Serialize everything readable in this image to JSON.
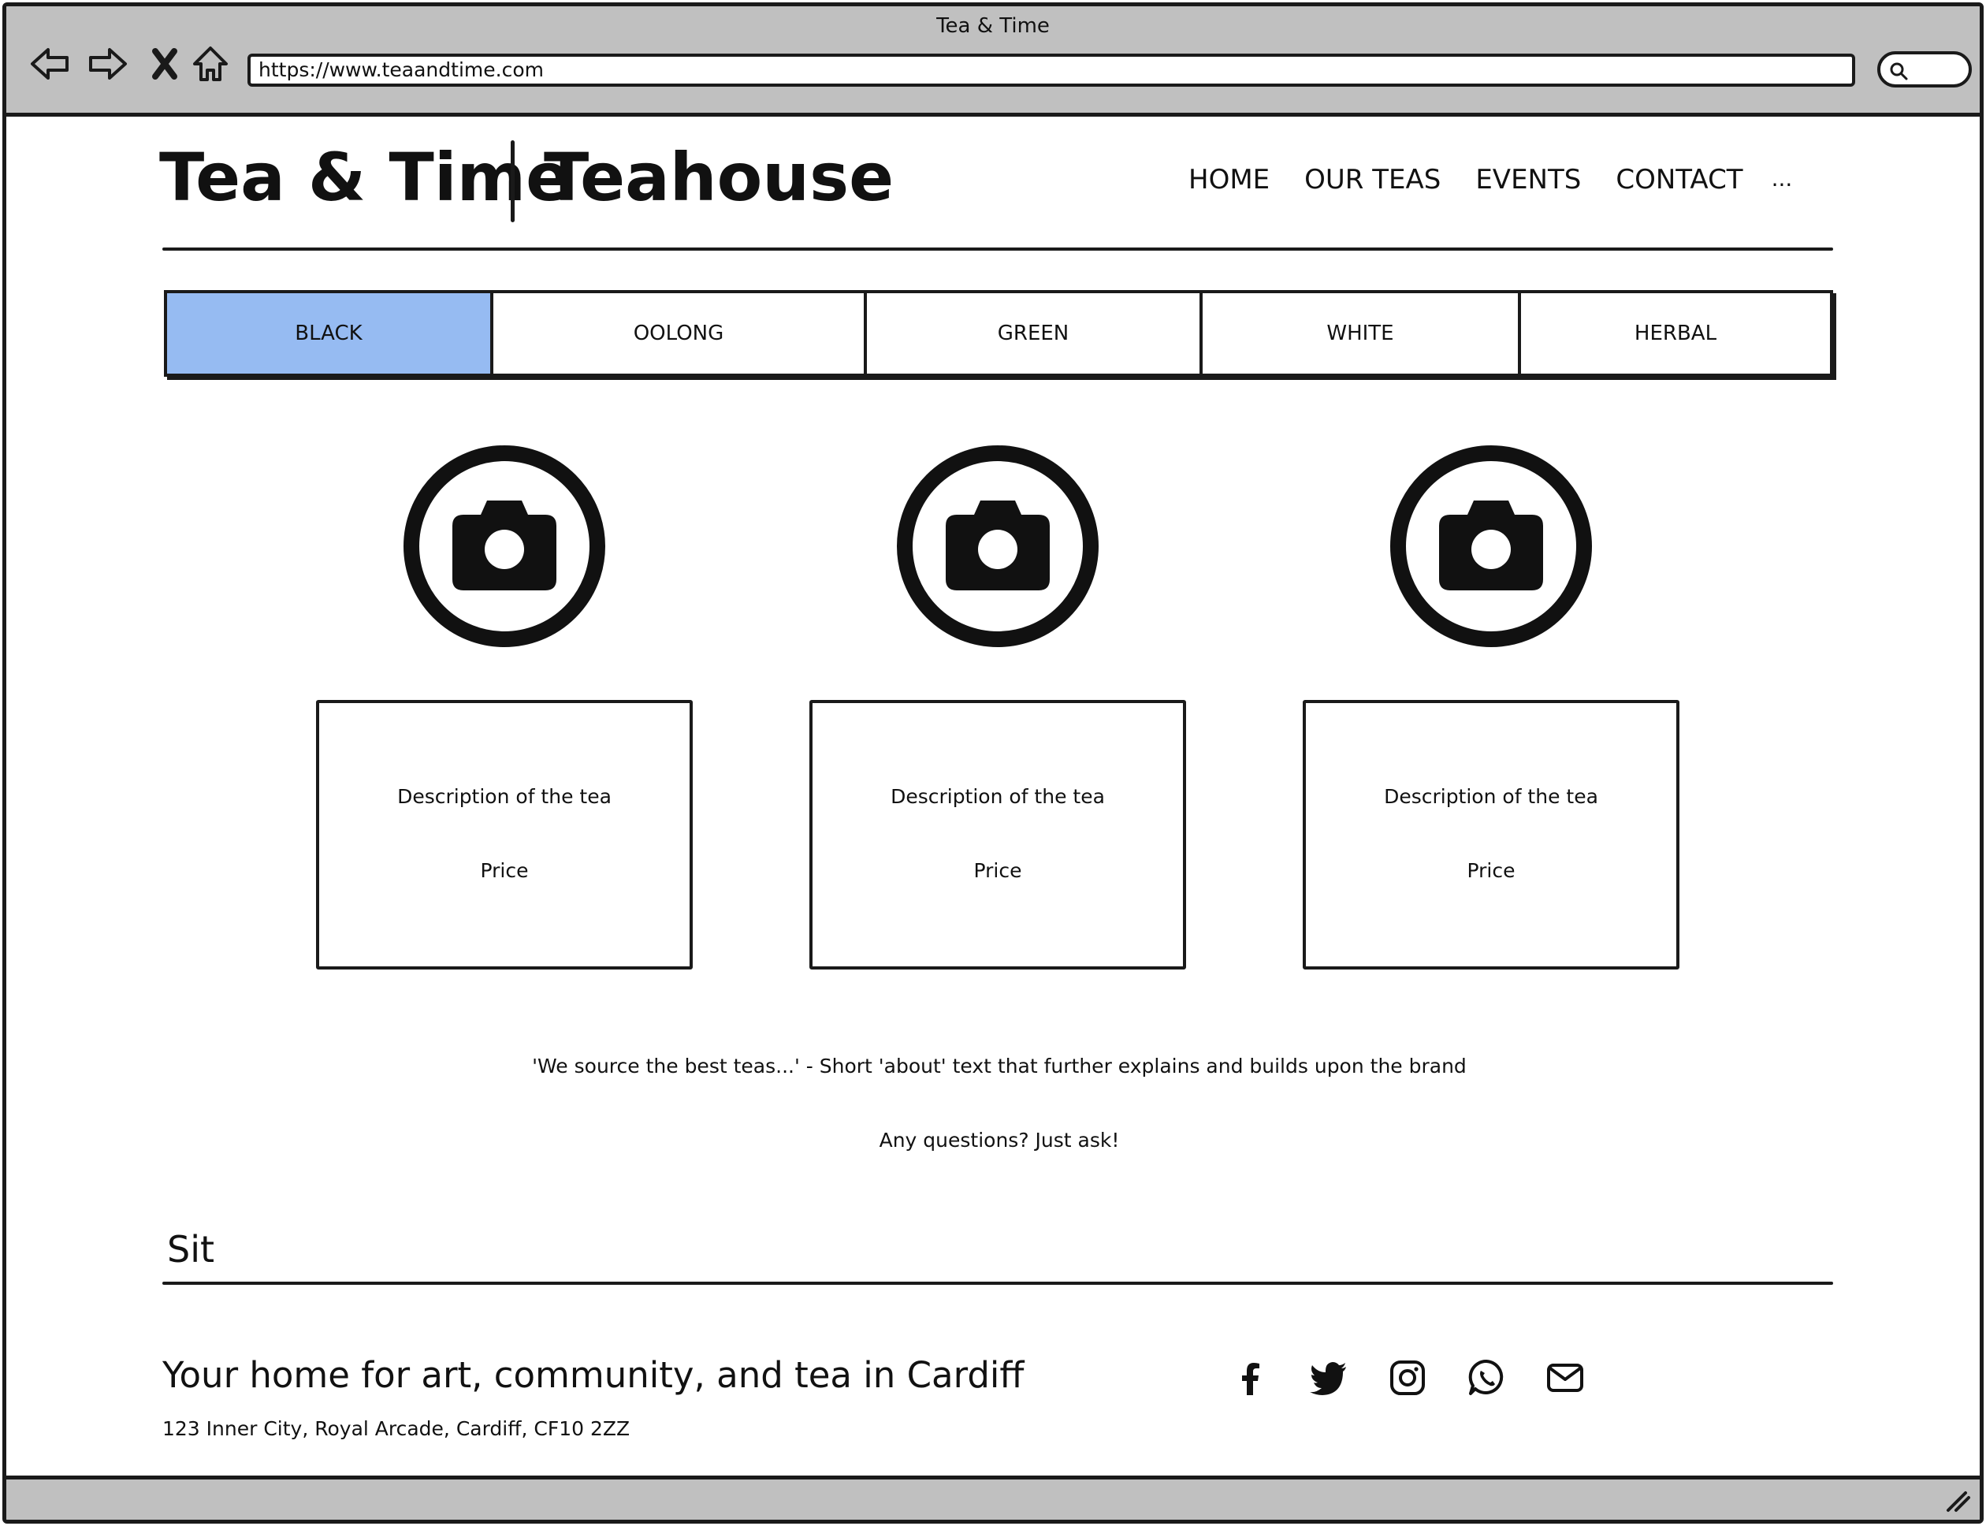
{
  "browser": {
    "window_title": "Tea & Time",
    "url": "https://www.teaandtime.com"
  },
  "header": {
    "brand_name": "Tea & Time",
    "brand_suffix": "Teahouse",
    "nav": [
      "HOME",
      "OUR TEAS",
      "EVENTS",
      "CONTACT"
    ],
    "nav_more": "..."
  },
  "tabs": [
    {
      "label": "BLACK",
      "active": true
    },
    {
      "label": "OOLONG",
      "active": false
    },
    {
      "label": "GREEN",
      "active": false
    },
    {
      "label": "WHITE",
      "active": false
    },
    {
      "label": "HERBAL",
      "active": false
    }
  ],
  "products": [
    {
      "icon": "camera-icon",
      "description": "Description of the tea",
      "price": "Price"
    },
    {
      "icon": "camera-icon",
      "description": "Description of the tea",
      "price": "Price"
    },
    {
      "icon": "camera-icon",
      "description": "Description of the tea",
      "price": "Price"
    }
  ],
  "about": {
    "text": "'We source the best teas...' - Short 'about' text that further explains and builds upon the brand",
    "question": "Any questions? Just ask!"
  },
  "section_label": "Sit",
  "footer": {
    "tagline": "Your home for art, community, and tea in Cardiff",
    "address": "123 Inner City, Royal Arcade, Cardiff, CF10 2ZZ",
    "social_icons": [
      "facebook-icon",
      "twitter-icon",
      "instagram-icon",
      "whatsapp-icon",
      "email-icon"
    ]
  },
  "colors": {
    "chrome": "#c0c0c0",
    "active_tab": "#96bbf2",
    "ink": "#1a1a1a"
  }
}
